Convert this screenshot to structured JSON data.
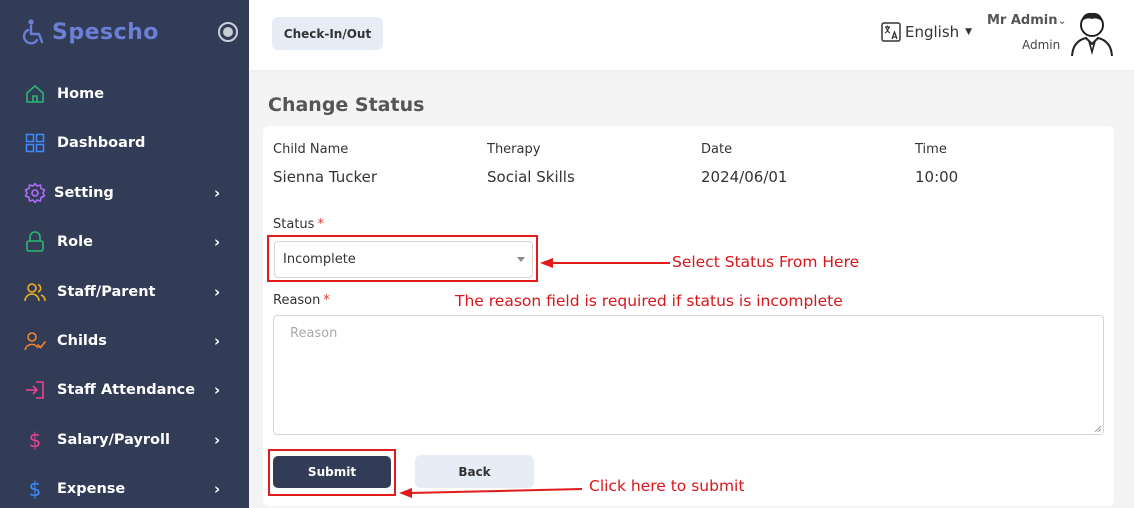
{
  "app": {
    "logo_text": "Spescho",
    "brand_color": "#6b7fd6",
    "sidebar_color": "#333c57"
  },
  "sidebar": {
    "items": [
      {
        "label": "Home",
        "icon": "home-icon",
        "icon_color": "#2bb673",
        "has_chevron": false
      },
      {
        "label": "Dashboard",
        "icon": "grid-icon",
        "icon_color": "#3d8bfd",
        "has_chevron": false
      },
      {
        "label": "Setting",
        "icon": "gear-icon",
        "icon_color": "#b36bff",
        "has_chevron": true
      },
      {
        "label": "Role",
        "icon": "lock-icon",
        "icon_color": "#2bb673",
        "has_chevron": true
      },
      {
        "label": "Staff/Parent",
        "icon": "users-icon",
        "icon_color": "#f2b01e",
        "has_chevron": true
      },
      {
        "label": "Childs",
        "icon": "user-check-icon",
        "icon_color": "#f5862a",
        "has_chevron": true
      },
      {
        "label": "Staff Attendance",
        "icon": "login-icon",
        "icon_color": "#e84393",
        "has_chevron": true
      },
      {
        "label": "Salary/Payroll",
        "icon": "dollar-icon",
        "icon_color": "#e84393",
        "has_chevron": true
      },
      {
        "label": "Expense",
        "icon": "dollar-icon",
        "icon_color": "#3d8bfd",
        "has_chevron": true
      }
    ]
  },
  "header": {
    "checkin_label": "Check-In/Out",
    "language": "English",
    "user_name": "Mr Admin",
    "user_role": "Admin"
  },
  "page": {
    "title": "Change Status",
    "info": [
      {
        "label": "Child Name",
        "value": "Sienna Tucker"
      },
      {
        "label": "Therapy",
        "value": "Social Skills"
      },
      {
        "label": "Date",
        "value": "2024/06/01"
      },
      {
        "label": "Time",
        "value": "10:00"
      }
    ],
    "status_label": "Status",
    "status_value": "Incomplete",
    "reason_label": "Reason",
    "reason_placeholder": "Reason",
    "required_mark": "*",
    "submit_label": "Submit",
    "back_label": "Back"
  },
  "annotations": {
    "status_note": "Select Status From Here",
    "reason_note": "The reason field is required if status is incomplete",
    "submit_note": "Click here to submit",
    "color": "#e31b1b"
  }
}
